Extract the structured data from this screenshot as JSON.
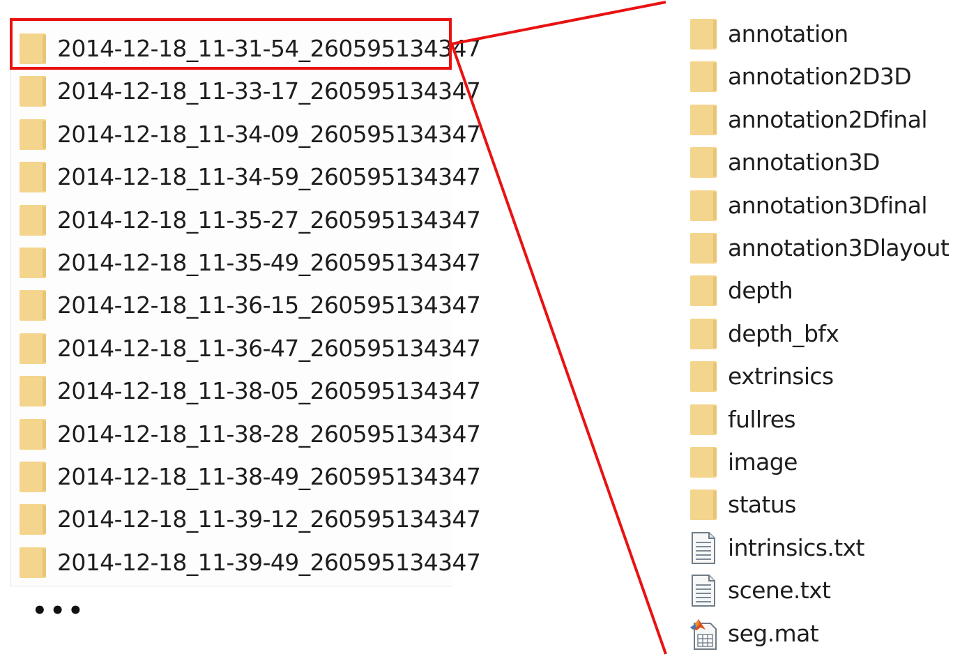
{
  "left_folders": [
    "2014-12-18_11-31-54_260595134347",
    "2014-12-18_11-33-17_260595134347",
    "2014-12-18_11-34-09_260595134347",
    "2014-12-18_11-34-59_260595134347",
    "2014-12-18_11-35-27_260595134347",
    "2014-12-18_11-35-49_260595134347",
    "2014-12-18_11-36-15_260595134347",
    "2014-12-18_11-36-47_260595134347",
    "2014-12-18_11-38-05_260595134347",
    "2014-12-18_11-38-28_260595134347",
    "2014-12-18_11-38-49_260595134347",
    "2014-12-18_11-39-12_260595134347",
    "2014-12-18_11-39-49_260595134347"
  ],
  "more_indicator": "•••",
  "right_items": [
    {
      "name": "annotation",
      "icon": "folder-icon"
    },
    {
      "name": "annotation2D3D",
      "icon": "folder-icon"
    },
    {
      "name": "annotation2Dfinal",
      "icon": "folder-icon"
    },
    {
      "name": "annotation3D",
      "icon": "folder-icon"
    },
    {
      "name": "annotation3Dfinal",
      "icon": "folder-icon"
    },
    {
      "name": "annotation3Dlayout",
      "icon": "folder-icon"
    },
    {
      "name": "depth",
      "icon": "folder-icon"
    },
    {
      "name": "depth_bfx",
      "icon": "folder-icon"
    },
    {
      "name": "extrinsics",
      "icon": "folder-icon"
    },
    {
      "name": "fullres",
      "icon": "folder-icon"
    },
    {
      "name": "image",
      "icon": "folder-icon"
    },
    {
      "name": "status",
      "icon": "folder-icon"
    },
    {
      "name": "intrinsics.txt",
      "icon": "text-file-icon"
    },
    {
      "name": "scene.txt",
      "icon": "text-file-icon"
    },
    {
      "name": "seg.mat",
      "icon": "matlab-file-icon"
    }
  ],
  "colors": {
    "highlight": "#e81212",
    "folder": "#f4d58d"
  }
}
